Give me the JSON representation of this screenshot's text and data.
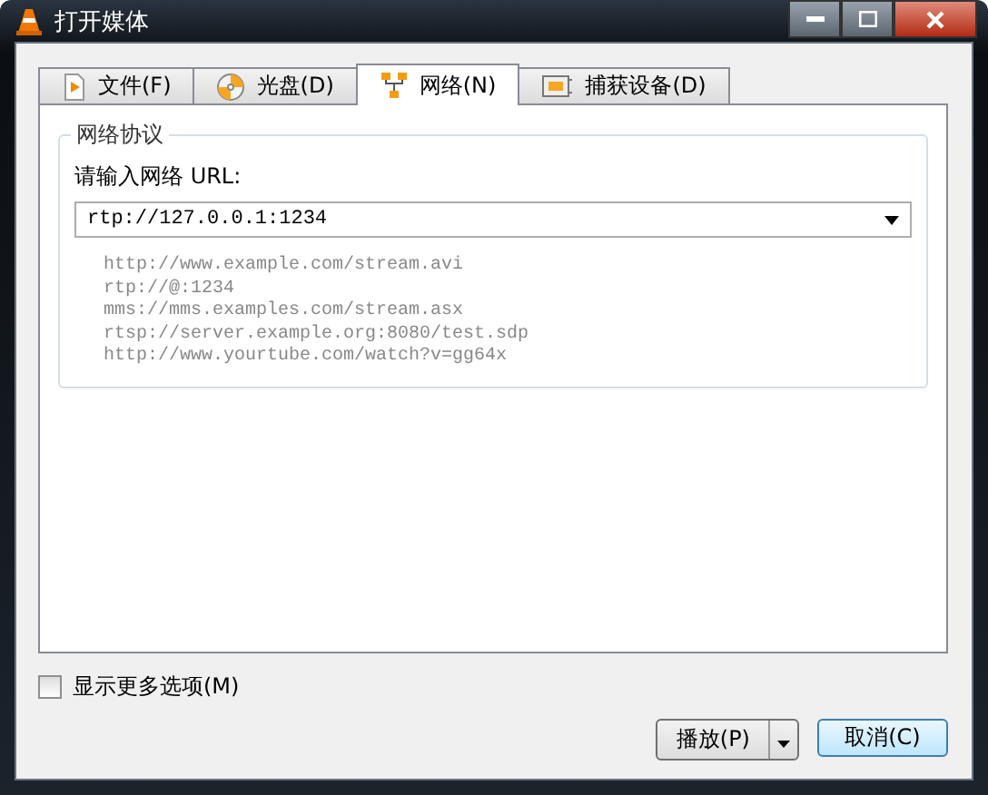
{
  "window": {
    "title": "打开媒体"
  },
  "tabs": [
    {
      "label": "文件(F)",
      "selected": false
    },
    {
      "label": "光盘(D)",
      "selected": false
    },
    {
      "label": "网络(N)",
      "selected": true
    },
    {
      "label": "捕获设备(D)",
      "selected": false
    }
  ],
  "group": {
    "title": "网络协议",
    "prompt": "请输入网络 URL:",
    "url_field": {
      "value": "rtp://127.0.0.1:1234"
    },
    "examples": [
      "http://www.example.com/stream.avi",
      "rtp://@:1234",
      "mms://mms.examples.com/stream.asx",
      "rtsp://server.example.org:8080/test.sdp",
      "http://www.yourtube.com/watch?v=gg64x"
    ]
  },
  "more_options": {
    "label": "显示更多选项(M)",
    "checked": false
  },
  "buttons": {
    "play": "播放(P)",
    "cancel": "取消(C)"
  }
}
